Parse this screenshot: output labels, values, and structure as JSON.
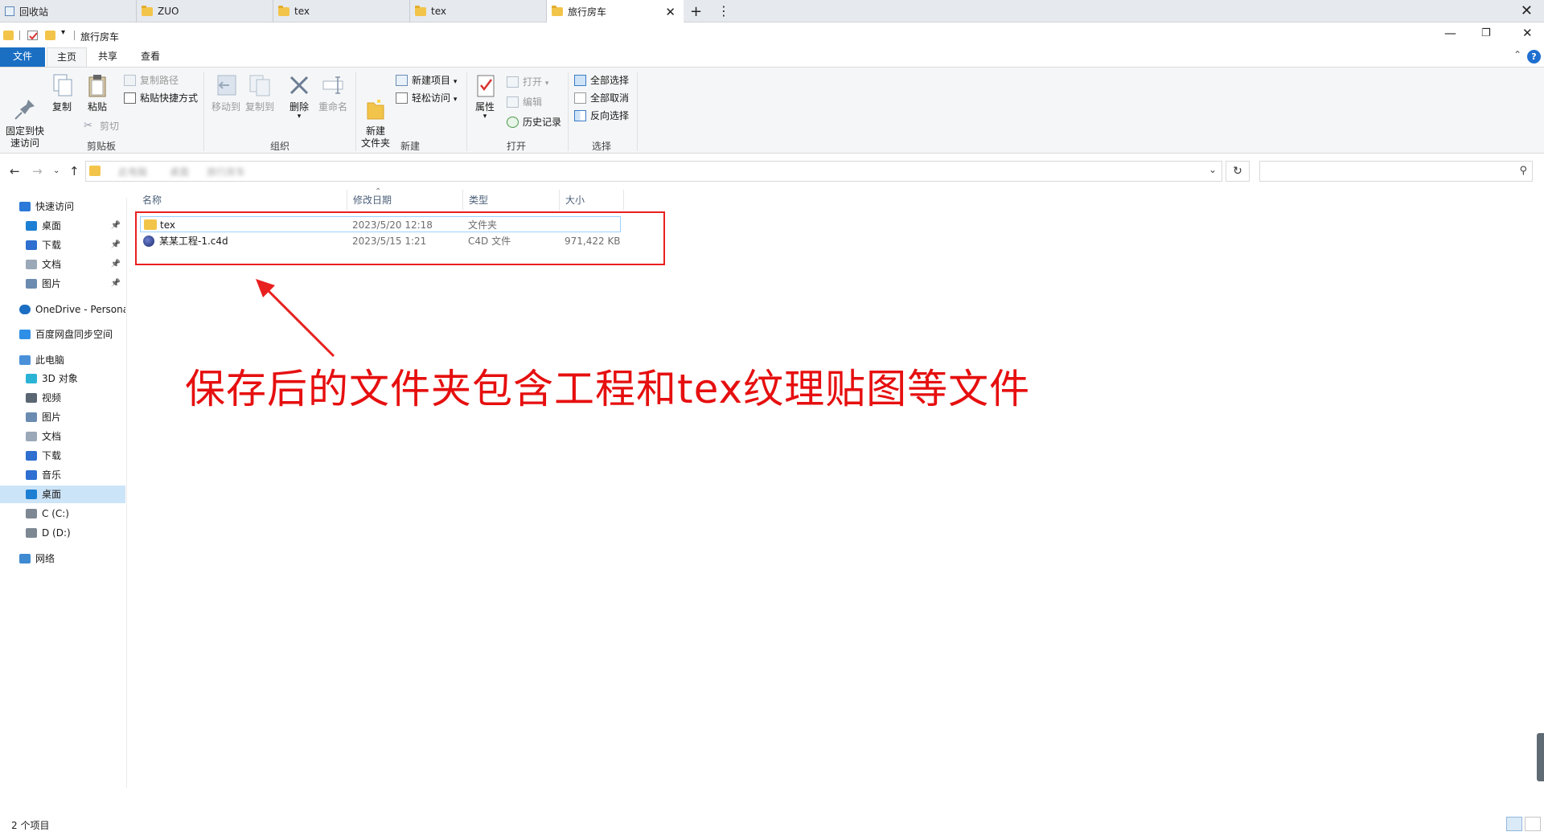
{
  "tabs": [
    {
      "label": "回收站",
      "active": false
    },
    {
      "label": "ZUO",
      "active": false
    },
    {
      "label": "tex",
      "active": false
    },
    {
      "label": "tex",
      "active": false
    },
    {
      "label": "旅行房车",
      "active": true
    }
  ],
  "window": {
    "title": "旅行房车"
  },
  "ribbon_tabs": {
    "file": "文件",
    "home": "主页",
    "share": "共享",
    "view": "查看"
  },
  "ribbon": {
    "clipboard": {
      "group": "剪贴板",
      "pin": "固定到快\n速访问",
      "copy": "复制",
      "paste": "粘贴",
      "copy_path": "复制路径",
      "paste_shortcut": "粘贴快捷方式",
      "cut": "剪切"
    },
    "organize": {
      "group": "组织",
      "move_to": "移动到",
      "copy_to": "复制到",
      "delete": "删除",
      "rename": "重命名"
    },
    "new": {
      "group": "新建",
      "new_folder": "新建\n文件夹",
      "new_item": "新建项目",
      "easy_access": "轻松访问"
    },
    "open": {
      "group": "打开",
      "properties": "属性",
      "open": "打开",
      "edit": "编辑",
      "history": "历史记录"
    },
    "select": {
      "group": "选择",
      "select_all": "全部选择",
      "select_none": "全部取消",
      "invert": "反向选择"
    }
  },
  "address": {
    "crumbs": [
      "此电脑",
      "桌面",
      "旅行房车"
    ]
  },
  "sidebar": {
    "items": [
      {
        "label": "快速访问",
        "icon": "star-icon",
        "indent": 0
      },
      {
        "label": "桌面",
        "icon": "desktop-icon",
        "indent": 1,
        "pinned": true
      },
      {
        "label": "下载",
        "icon": "download-icon",
        "indent": 1,
        "pinned": true
      },
      {
        "label": "文档",
        "icon": "document-icon",
        "indent": 1,
        "pinned": true
      },
      {
        "label": "图片",
        "icon": "picture-icon",
        "indent": 1,
        "pinned": true
      },
      {
        "label": "OneDrive - Persona",
        "icon": "cloud-icon",
        "indent": 0
      },
      {
        "label": "百度网盘同步空间",
        "icon": "sync-folder-icon",
        "indent": 0
      },
      {
        "label": "此电脑",
        "icon": "computer-icon",
        "indent": 0
      },
      {
        "label": "3D 对象",
        "icon": "cube-icon",
        "indent": 1
      },
      {
        "label": "视频",
        "icon": "video-icon",
        "indent": 1
      },
      {
        "label": "图片",
        "icon": "picture-icon",
        "indent": 1
      },
      {
        "label": "文档",
        "icon": "document-icon",
        "indent": 1
      },
      {
        "label": "下载",
        "icon": "download-icon",
        "indent": 1
      },
      {
        "label": "音乐",
        "icon": "music-icon",
        "indent": 1
      },
      {
        "label": "桌面",
        "icon": "desktop-icon",
        "indent": 1,
        "selected": true
      },
      {
        "label": "C (C:)",
        "icon": "drive-icon",
        "indent": 1
      },
      {
        "label": "D (D:)",
        "icon": "drive-icon",
        "indent": 1
      },
      {
        "label": "网络",
        "icon": "network-icon",
        "indent": 0
      }
    ]
  },
  "columns": {
    "name": "名称",
    "modified": "修改日期",
    "type": "类型",
    "size": "大小"
  },
  "files": [
    {
      "name": "tex",
      "modified": "2023/5/20 12:18",
      "type": "文件夹",
      "size": "",
      "icon": "folder-icon"
    },
    {
      "name": "某某工程-1.c4d",
      "modified": "2023/5/15 1:21",
      "type": "C4D 文件",
      "size": "971,422 KB",
      "icon": "c4d-file-icon"
    }
  ],
  "annotation": {
    "text": "保存后的文件夹包含工程和tex纹理贴图等文件",
    "color": "#e60f0f"
  },
  "status": {
    "count": "2 个项目"
  },
  "colors": {
    "accent": "#1a6fc3",
    "folder": "#f3c44a",
    "selection": "#cce4f7"
  }
}
